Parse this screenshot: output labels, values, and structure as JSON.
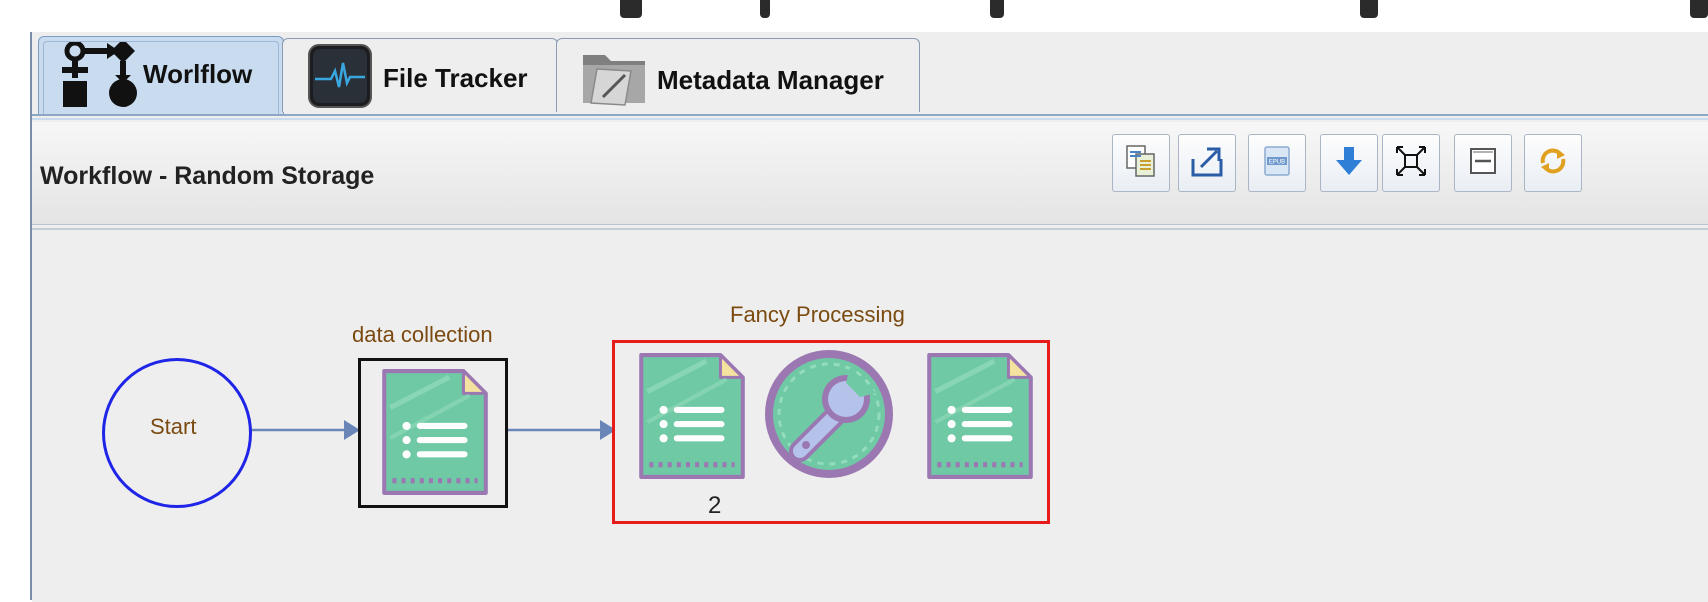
{
  "tabs": [
    {
      "label": "Worlflow",
      "icon": "workflow-icon",
      "active": true
    },
    {
      "label": "File Tracker",
      "icon": "heartbeat-monitor-icon",
      "active": false
    },
    {
      "label": "Metadata Manager",
      "icon": "folder-edit-icon",
      "active": false
    }
  ],
  "panel": {
    "title": "Workflow - Random Storage"
  },
  "toolbar": [
    {
      "icon": "copy-document-icon"
    },
    {
      "icon": "export-icon"
    },
    {
      "icon": "epub-icon",
      "text": "EPUB"
    },
    {
      "icon": "download-arrow-icon"
    },
    {
      "icon": "fit-to-screen-icon"
    },
    {
      "icon": "collapse-icon"
    },
    {
      "icon": "refresh-icon"
    }
  ],
  "workflow": {
    "start_label": "Start",
    "task_label": "data collection",
    "group_label": "Fancy Processing",
    "group_count": "2"
  },
  "colors": {
    "active_tab": "#c9dcef",
    "start_circle": "#1f25e8",
    "group_border": "#e81b1b",
    "task_border": "#111111",
    "edge": "#6a86b8",
    "doc_green": "#6fc9a4",
    "doc_outline": "#9b78b2",
    "doc_fold": "#f3e3a0",
    "label_brown": "#7a4a10"
  }
}
